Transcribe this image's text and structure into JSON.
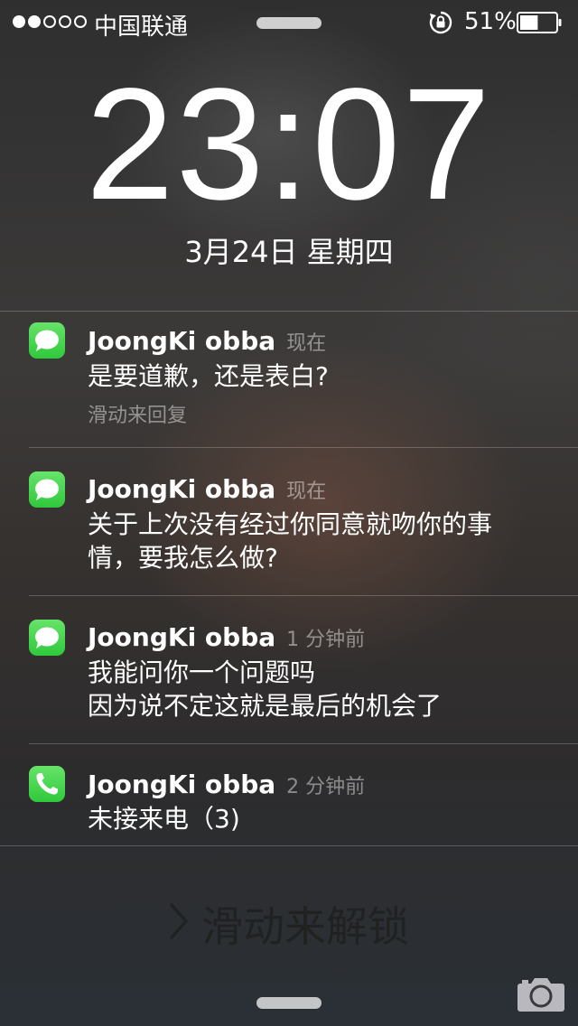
{
  "status_bar": {
    "signal": {
      "filled": 2,
      "total": 5
    },
    "carrier": "中国联通",
    "battery_percent": "51%",
    "battery_level": 0.51,
    "rotation_lock_icon": "rotation-lock-icon"
  },
  "lock_screen": {
    "time": "23:07",
    "date": "3月24日 星期四"
  },
  "notifications": [
    {
      "app_icon": "messages-icon",
      "sender": "JoongKi obba",
      "time": "现在",
      "message": "是要道歉，还是表白?",
      "hint": "滑动来回复"
    },
    {
      "app_icon": "messages-icon",
      "sender": "JoongKi obba",
      "time": "现在",
      "message_lines": [
        "关于上次没有经过你同意就吻你的事",
        "情，要我怎么做?"
      ]
    },
    {
      "app_icon": "messages-icon",
      "sender": "JoongKi obba",
      "time": "1 分钟前",
      "message_lines": [
        "我能问你一个问题吗",
        "因为说不定这就是最后的机会了"
      ]
    },
    {
      "app_icon": "phone-icon",
      "sender": "JoongKi obba",
      "time": "2 分钟前",
      "message": "未接来电（3)"
    }
  ],
  "unlock": {
    "label": "滑动来解锁",
    "chevron_icon": "chevron-right-icon"
  },
  "camera": {
    "icon": "camera-icon"
  },
  "colors": {
    "accent_green": "#4cd964"
  }
}
